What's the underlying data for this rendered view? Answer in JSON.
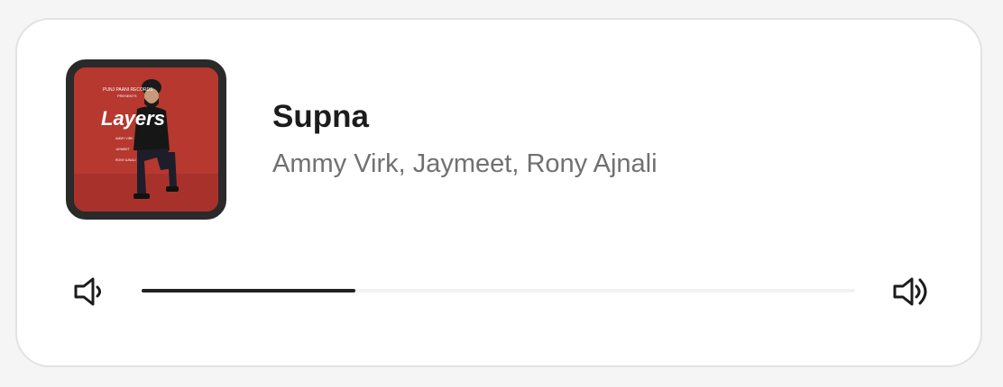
{
  "track": {
    "title": "Supna",
    "artists": "Ammy Virk, Jaymeet, Rony Ajnali"
  },
  "album_art": {
    "text": "Layers",
    "icon": "album-art-image"
  },
  "volume": {
    "level": 0.3,
    "decrease_icon": "volume-low-icon",
    "increase_icon": "volume-high-icon"
  },
  "colors": {
    "accent": "#222222",
    "art_background": "#b6382f"
  }
}
